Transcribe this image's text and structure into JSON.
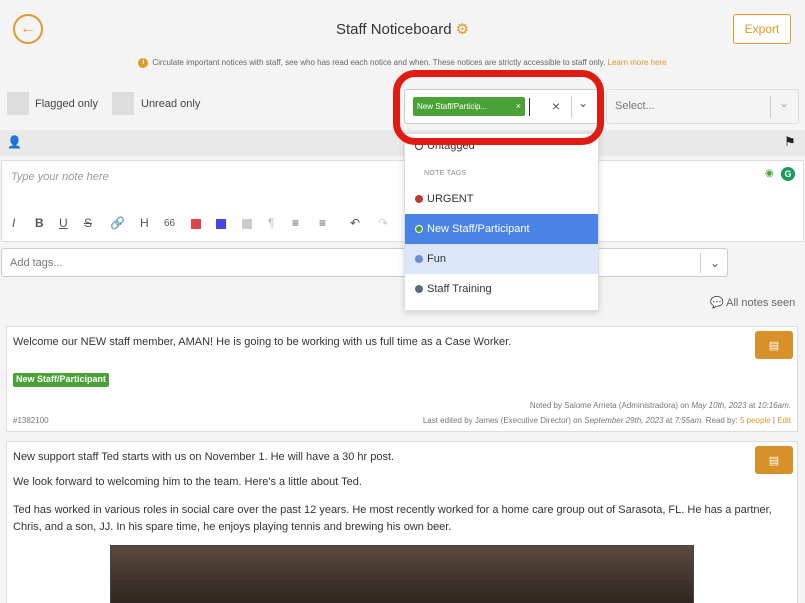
{
  "header": {
    "title": "Staff Noticeboard",
    "export_label": "Export",
    "info_text": "Circulate important notices with staff, see who has read each notice and when. These notices are strictly accessible to staff only.",
    "learn_more": "Learn more here"
  },
  "filters": {
    "flagged_label": "Flagged only",
    "unread_label": "Unread only",
    "selected_tag": "New Staff/Particip...",
    "clear_glyph": "×",
    "select_placeholder": "Select..."
  },
  "composer": {
    "placeholder": "Type your note here",
    "tags_placeholder": "Add tags..."
  },
  "dropdown": {
    "untagged": "Untagged",
    "group_label": "NOTE TAGS",
    "options": [
      {
        "label": "URGENT",
        "color": "#c0392b"
      },
      {
        "label": "New Staff/Participant",
        "color": "#4aa236"
      },
      {
        "label": "Fun",
        "color": "#6b8cd6"
      },
      {
        "label": "Staff Training",
        "color": "#5a6e75"
      }
    ],
    "highlight_color": "#4a82e6"
  },
  "all_notes_seen": "All notes seen",
  "notes": [
    {
      "body": "Welcome our NEW staff member, AMAN! He is going to be working with us full time as a Case Worker.",
      "tag": "New Staff/Participant",
      "id": "#1382100",
      "noted_by": "Noted by Salome Arrieta (Administradora)  on",
      "noted_date": "May 10th, 2023",
      "noted_at": "at",
      "noted_time": "10:16am.",
      "edited_by": "Last edited by James (Executive Director) on",
      "edited_date": "September 29th, 2023",
      "edited_at": "at",
      "edited_time": "7:55am.",
      "read_by": "Read by:",
      "read_count": "5 people",
      "edit_link": "Edit"
    },
    {
      "p1": "New support staff Ted starts with us on November 1. He will have a 30 hr post.",
      "p2": "We look forward to welcoming him to the team. Here's a little about Ted.",
      "p3": "Ted has worked in various roles in social care over the past 12 years. He most recently worked for a home care group out of Sarasota, FL. He has a partner, Chris, and a son, JJ. In his spare time, he enjoys playing tennis and brewing his own beer."
    }
  ],
  "colors": {
    "accent": "#e09a2c",
    "tag_green": "#4aa236",
    "annotation_red": "#e01b12"
  }
}
